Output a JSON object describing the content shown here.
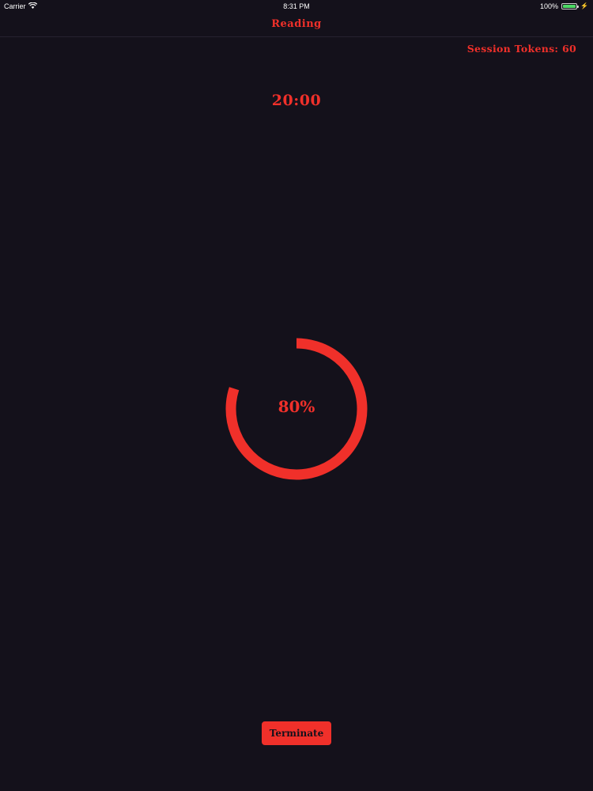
{
  "status_bar": {
    "carrier": "Carrier",
    "wifi_icon": "wifi-icon",
    "time": "8:31 PM",
    "battery_percent_label": "100%",
    "battery_level": 1.0,
    "battery_icon": "battery-icon",
    "charging_icon": "bolt-icon"
  },
  "nav": {
    "title": "Reading"
  },
  "session": {
    "tokens_label": "Session Tokens: 60"
  },
  "timer": {
    "value": "20:00"
  },
  "progress": {
    "label": "80%",
    "fraction": 0.8
  },
  "actions": {
    "terminate_label": "Terminate"
  },
  "colors": {
    "background": "#14111b",
    "accent": "#f0302a",
    "battery": "#4cd964"
  }
}
